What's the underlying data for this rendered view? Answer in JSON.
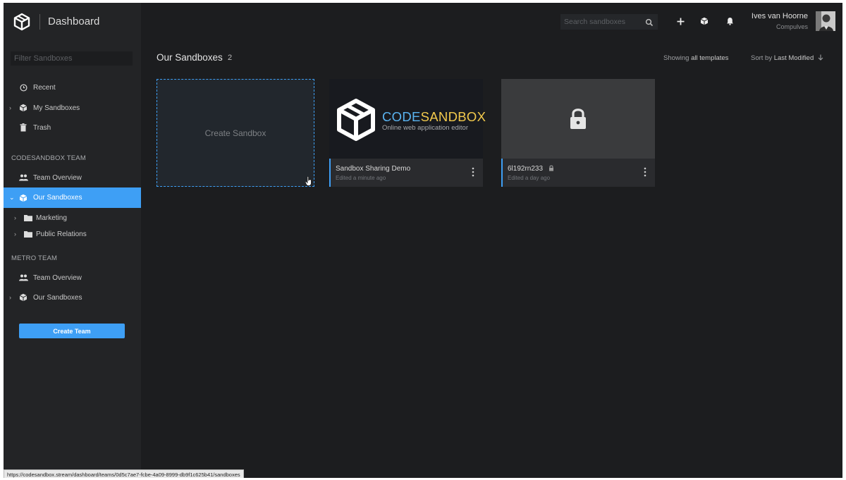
{
  "header": {
    "app_title": "Dashboard",
    "search_placeholder": "Search sandboxes",
    "user_name": "Ives van Hoorne",
    "user_team": "Compulves"
  },
  "sidebar": {
    "filter_placeholder": "Filter Sandboxes",
    "items": [
      {
        "label": "Recent",
        "icon": "clock-icon"
      },
      {
        "label": "My Sandboxes",
        "icon": "cube-icon"
      },
      {
        "label": "Trash",
        "icon": "trash-icon"
      }
    ],
    "teams": [
      {
        "name": "CODESANDBOX TEAM",
        "overview_label": "Team Overview",
        "sandboxes_label": "Our Sandboxes",
        "folders": [
          "Marketing",
          "Public Relations"
        ]
      },
      {
        "name": "METRO TEAM",
        "overview_label": "Team Overview",
        "sandboxes_label": "Our Sandboxes"
      }
    ],
    "create_team_label": "Create Team"
  },
  "main": {
    "title": "Our Sandboxes",
    "count": "2",
    "showing_prefix": "Showing",
    "showing_value": "all templates",
    "sort_prefix": "Sort by",
    "sort_value": "Last Modified",
    "create_label": "Create Sandbox",
    "cards": [
      {
        "name": "Sandbox Sharing Demo",
        "edited": "Edited a minute ago",
        "thumb_word_a": "CODE",
        "thumb_word_b": "SANDBOX",
        "thumb_sub": "Online web application editor"
      },
      {
        "name": "6l192rn233",
        "edited": "Edited a day ago"
      }
    ]
  },
  "status_url": "https://codesandbox.stream/dashboard/teams/0d5c7ae7-fcbe-4a09-8999-db9f1c625b41/sandboxes",
  "colors": {
    "accent": "#3e9ff5",
    "background": "#1c1d1f",
    "sidebar": "#232426",
    "card": "#2a2b2e"
  }
}
